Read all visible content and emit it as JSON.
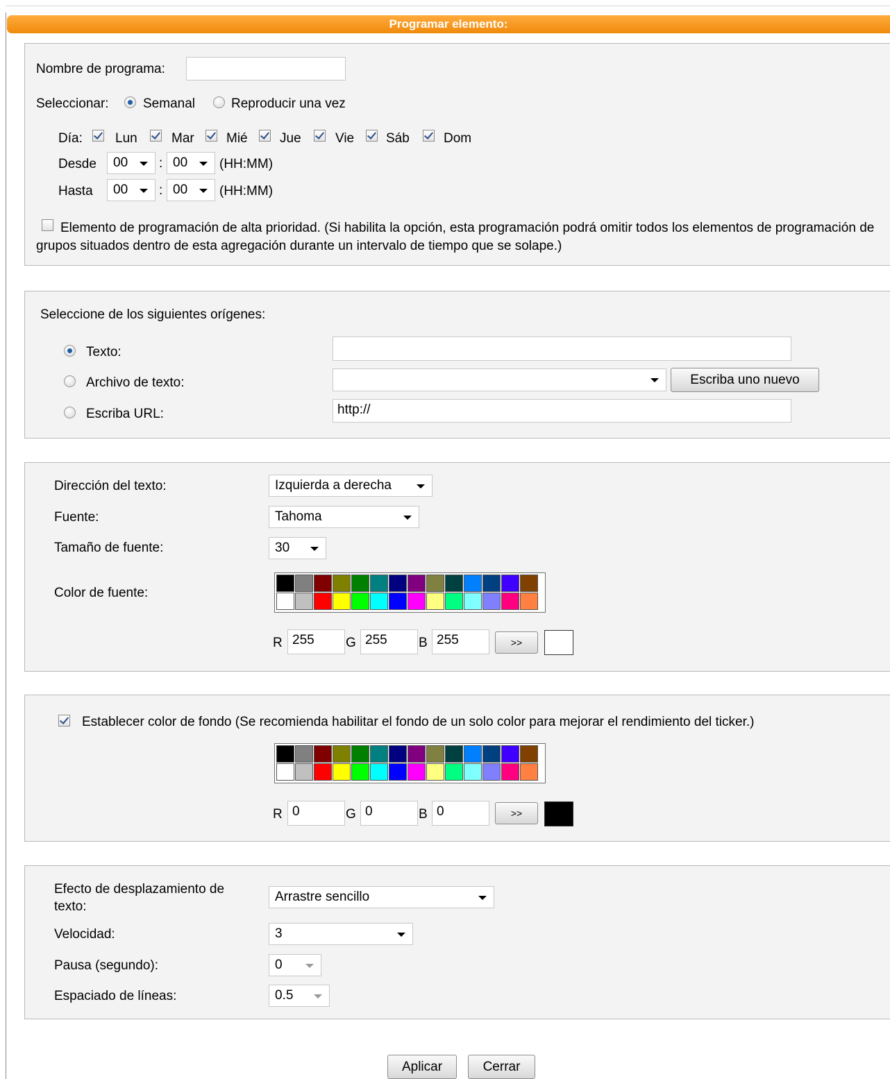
{
  "title": "Programar elemento:",
  "schedule": {
    "name_label": "Nombre de programa:",
    "name_value": "",
    "select_label": "Seleccionar:",
    "weekly_label": "Semanal",
    "once_label": "Reproducir una vez",
    "mode_selected": "weekly",
    "day_label": "Día:",
    "days": [
      {
        "label": "Lun",
        "checked": true
      },
      {
        "label": "Mar",
        "checked": true
      },
      {
        "label": "Mié",
        "checked": true
      },
      {
        "label": "Jue",
        "checked": true
      },
      {
        "label": "Vie",
        "checked": true
      },
      {
        "label": "Sáb",
        "checked": true
      },
      {
        "label": "Dom",
        "checked": true
      }
    ],
    "from_label": "Desde",
    "to_label": "Hasta",
    "from_hour": "00",
    "from_minute": "00",
    "to_hour": "00",
    "to_minute": "00",
    "separator": ":",
    "time_format": "(HH:MM)",
    "high_priority_checked": false,
    "high_priority_text": "Elemento de programación de alta prioridad. (Si habilita la opción, esta programación podrá omitir todos los elementos de programación de grupos situados dentro de esta agregación durante un intervalo de tiempo que se solape.)"
  },
  "source": {
    "heading": "Seleccione de los siguientes orígenes:",
    "text_label": "Texto:",
    "text_value": "",
    "file_label": "Archivo de texto:",
    "file_value": "",
    "new_button": "Escriba uno nuevo",
    "url_label": "Escriba URL:",
    "url_value": "http://",
    "selected": "text"
  },
  "text_style": {
    "direction_label": "Dirección del texto:",
    "direction_value": "Izquierda a derecha",
    "font_label": "Fuente:",
    "font_value": "Tahoma",
    "size_label": "Tamaño de fuente:",
    "size_value": "30",
    "color_label": "Color de fuente:",
    "r_label": "R",
    "g_label": "G",
    "b_label": "B",
    "r": "255",
    "g": "255",
    "b": "255",
    "apply_button": ">>",
    "preview_color": "#ffffff"
  },
  "background": {
    "enabled": true,
    "label": "Establecer color de fondo (Se recomienda habilitar el fondo de un solo color para mejorar el rendimiento del ticker.)",
    "r_label": "R",
    "g_label": "G",
    "b_label": "B",
    "r": "0",
    "g": "0",
    "b": "0",
    "apply_button": ">>",
    "preview_color": "#000000"
  },
  "palette_colors": [
    "#000000",
    "#808080",
    "#800000",
    "#808000",
    "#008000",
    "#008080",
    "#000080",
    "#800080",
    "#808040",
    "#004040",
    "#0080ff",
    "#004080",
    "#4000ff",
    "#804000",
    "#ffffff",
    "#c0c0c0",
    "#ff0000",
    "#ffff00",
    "#00ff00",
    "#00ffff",
    "#0000ff",
    "#ff00ff",
    "#ffff80",
    "#00ff80",
    "#80ffff",
    "#8080ff",
    "#ff0080",
    "#ff8040"
  ],
  "scroll": {
    "effect_label": "Efecto de desplazamiento de texto:",
    "effect_value": "Arrastre sencillo",
    "speed_label": "Velocidad:",
    "speed_value": "3",
    "pause_label": "Pausa (segundo):",
    "pause_value": "0",
    "spacing_label": "Espaciado de líneas:",
    "spacing_value": "0.5"
  },
  "buttons": {
    "apply": "Aplicar",
    "close": "Cerrar"
  }
}
